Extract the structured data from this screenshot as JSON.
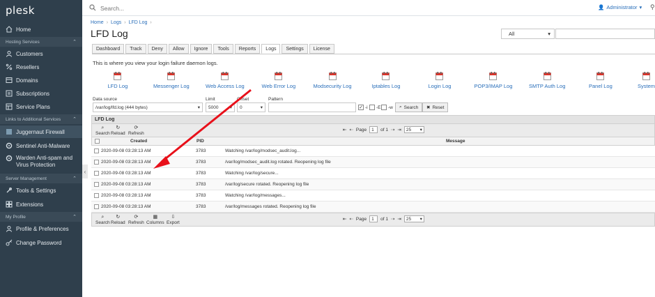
{
  "sidebar": {
    "logo": "plesk",
    "items": [
      {
        "label": "Home",
        "icon": "home-icon"
      },
      {
        "section": "Hosting Services"
      },
      {
        "label": "Customers",
        "icon": "user-icon"
      },
      {
        "label": "Resellers",
        "icon": "percent-icon"
      },
      {
        "label": "Domains",
        "icon": "globe-icon"
      },
      {
        "label": "Subscriptions",
        "icon": "subscriptions-icon"
      },
      {
        "label": "Service Plans",
        "icon": "plans-icon"
      },
      {
        "section": "Links to Additional Services"
      },
      {
        "label": "Juggernaut Firewall",
        "icon": "shield-icon"
      },
      {
        "label": "Sentinel Anti-Malware",
        "icon": "gear-icon"
      },
      {
        "label": "Warden Anti-spam and Virus Protection",
        "icon": "gear-icon"
      },
      {
        "section": "Server Management"
      },
      {
        "label": "Tools & Settings",
        "icon": "tools-icon"
      },
      {
        "label": "Extensions",
        "icon": "extensions-icon"
      },
      {
        "section": "My Profile"
      },
      {
        "label": "Profile & Preferences",
        "icon": "profile-icon"
      },
      {
        "label": "Change Password",
        "icon": "key-icon"
      }
    ]
  },
  "topbar": {
    "search_placeholder": "Search...",
    "user": "Administrator"
  },
  "breadcrumb": [
    "Home",
    "Logs",
    "LFD Log"
  ],
  "page_title": "LFD Log",
  "filter": {
    "select": "All"
  },
  "tabs": [
    "Dashboard",
    "Track",
    "Deny",
    "Allow",
    "Ignore",
    "Tools",
    "Reports",
    "Logs",
    "Settings",
    "License"
  ],
  "active_tab": "Logs",
  "intro": "This is where you view your login failure daemon logs.",
  "log_buttons": [
    "LFD Log",
    "Messenger Log",
    "Web Access Log",
    "Web Error Log",
    "Modsecurity Log",
    "Iptables Log",
    "Login Log",
    "POP3/IMAP Log",
    "SMTP Auth Log",
    "Panel Log",
    "System"
  ],
  "form": {
    "data_source_label": "Data source",
    "data_source_value": "/var/log/lfd.log (444 bytes)",
    "limit_label": "Limit",
    "limit_value": "5000",
    "offset_label": "Offset",
    "offset_value": "0",
    "pattern_label": "Pattern",
    "opt_i": "-i",
    "opt_e": "-E",
    "opt_w": "-w",
    "search_label": "Search",
    "reset_label": "Reset"
  },
  "grid": {
    "title": "LFD Log",
    "toolbar_top": [
      "Search",
      "Reload",
      "Refresh"
    ],
    "toolbar_bottom": [
      "Search",
      "Reload",
      "Refresh",
      "Columns",
      "Export"
    ],
    "page_label": "Page",
    "page_value": "1",
    "of_label": "of 1",
    "page_size": "25",
    "columns": [
      "Created",
      "PID",
      "Message"
    ],
    "rows": [
      [
        "2020-09-08 03:28:13 AM",
        "3783",
        "Watching /var/log/modsec_audit.log..."
      ],
      [
        "2020-09-08 03:28:13 AM",
        "3783",
        "/var/log/modsec_audit.log rotated. Reopening log file"
      ],
      [
        "2020-09-08 03:28:13 AM",
        "3783",
        "Watching /var/log/secure..."
      ],
      [
        "2020-09-08 03:28:13 AM",
        "3783",
        "/var/log/secure rotated. Reopening log file"
      ],
      [
        "2020-09-08 03:28:13 AM",
        "3783",
        "Watching /var/log/messages..."
      ],
      [
        "2020-09-08 03:28:13 AM",
        "3783",
        "/var/log/messages rotated. Reopening log file"
      ]
    ]
  },
  "colors": {
    "sidebar": "#2f3f4c",
    "link": "#2a6fba",
    "arrow": "#e8101a"
  }
}
